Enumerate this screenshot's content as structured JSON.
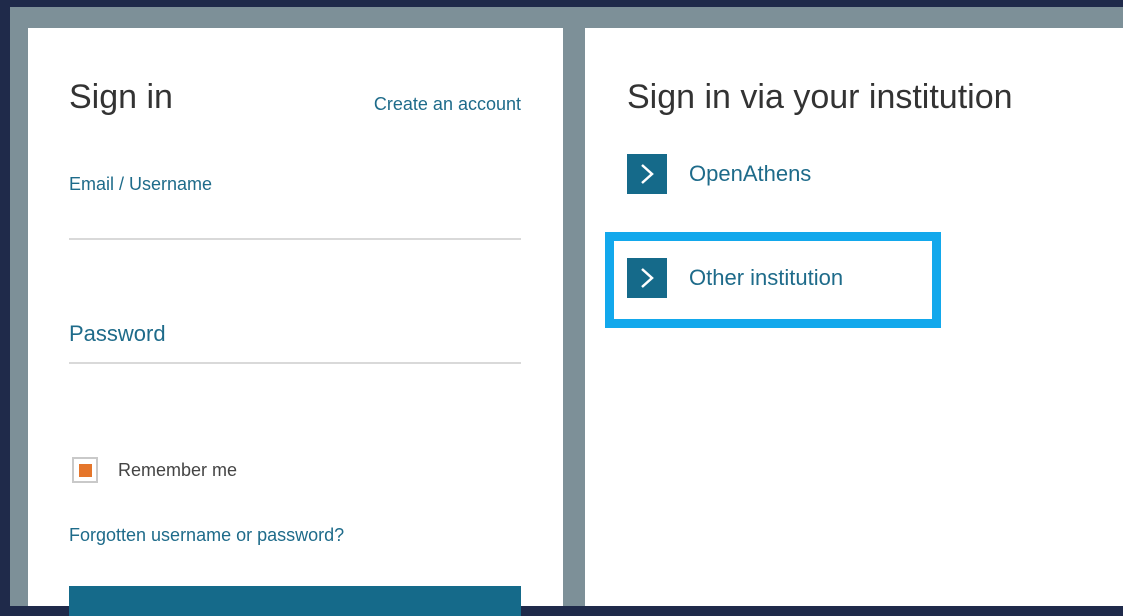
{
  "signin": {
    "title": "Sign in",
    "create_account": "Create an account",
    "email_label": "Email / Username",
    "email_value": "",
    "password_label": "Password",
    "password_value": "",
    "remember_me": "Remember me",
    "remember_checked": true,
    "forgot": "Forgotten username or password?"
  },
  "institution": {
    "title": "Sign in via your institution",
    "options": [
      {
        "label": "OpenAthens",
        "icon": "chevron-right-icon"
      },
      {
        "label": "Other institution",
        "icon": "chevron-right-icon",
        "highlighted": true
      }
    ]
  },
  "colors": {
    "accent": "#156a8a",
    "link": "#1e6b8a",
    "checkbox": "#e5762b",
    "highlight": "#12a8ec",
    "background": "#1f2a4a",
    "frame": "#7d9098"
  }
}
